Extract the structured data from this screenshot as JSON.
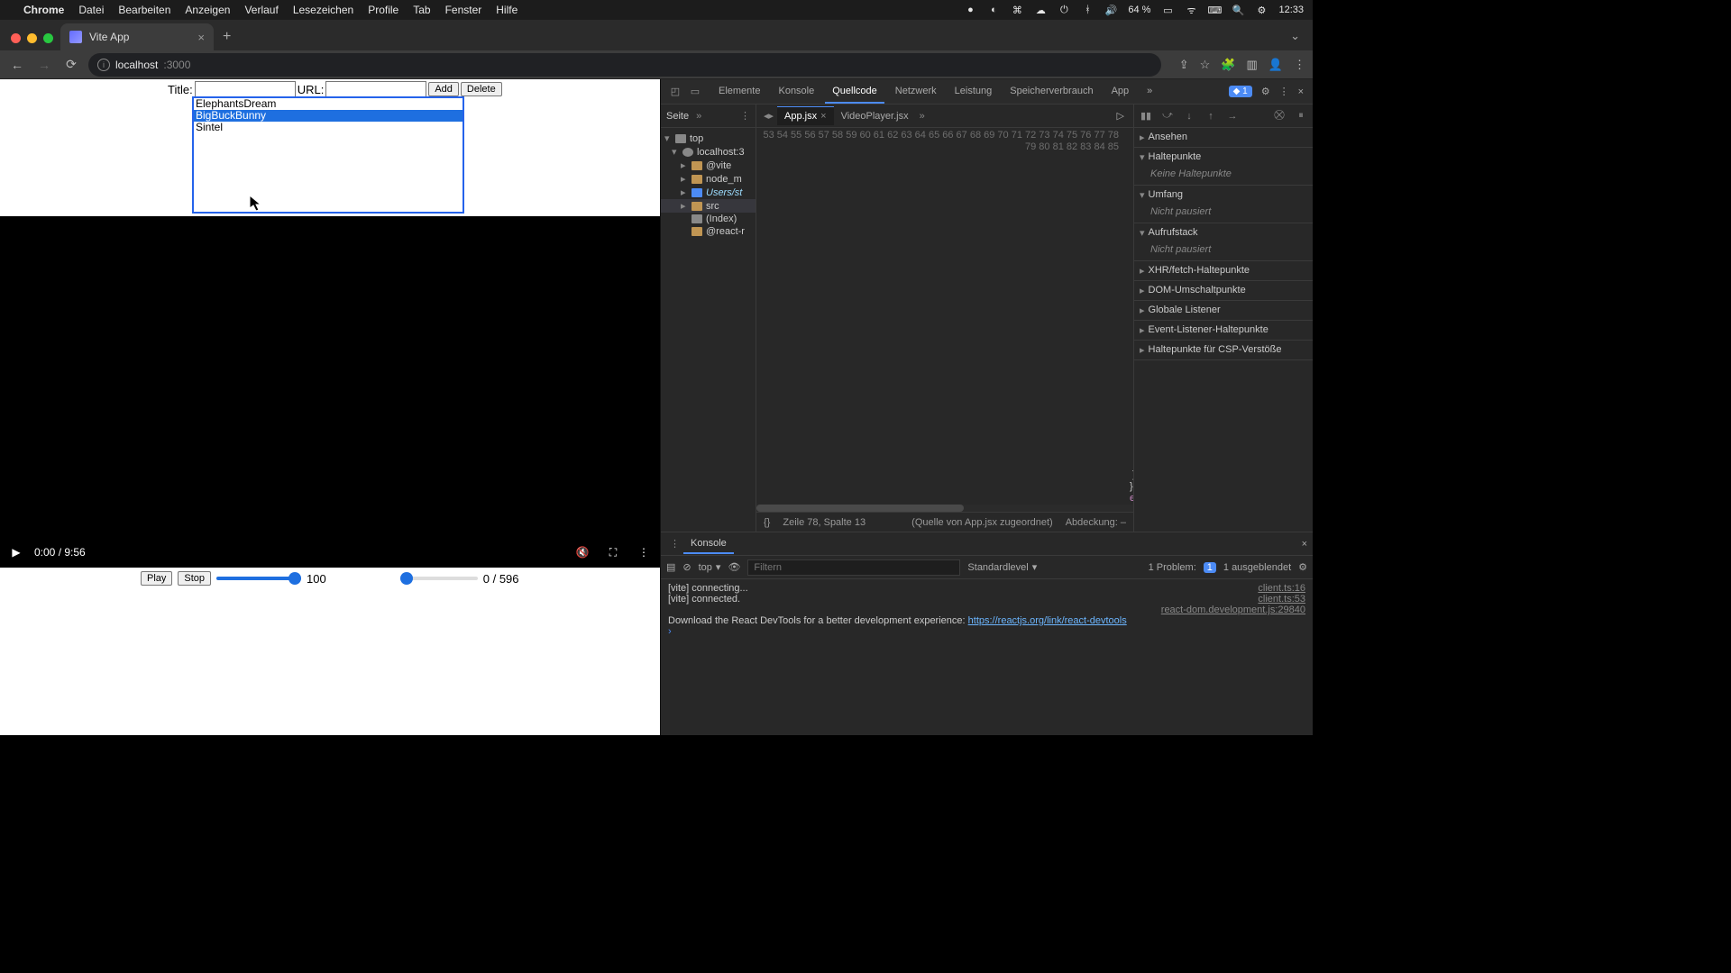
{
  "menubar": {
    "apple": "",
    "app": "Chrome",
    "items": [
      "Datei",
      "Bearbeiten",
      "Anzeigen",
      "Verlauf",
      "Lesezeichen",
      "Profile",
      "Tab",
      "Fenster",
      "Hilfe"
    ],
    "battery": "64 %",
    "time": "12:33"
  },
  "chrome": {
    "tab_title": "Vite App",
    "url_host": "localhost",
    "url_path": ":3000"
  },
  "page": {
    "title_label": "Title:",
    "url_label": "URL:",
    "add_btn": "Add",
    "delete_btn": "Delete",
    "options": [
      "ElephantsDream",
      "BigBuckBunny",
      "Sintel"
    ],
    "selected_index": 1,
    "video_time": "0:00 / 9:56",
    "play_btn": "Play",
    "stop_btn": "Stop",
    "vol_value": "100",
    "seek_value": "0 / 596"
  },
  "devtools": {
    "tabs": [
      "Elemente",
      "Konsole",
      "Quellcode",
      "Netzwerk",
      "Leistung",
      "Speicherverbrauch",
      "App"
    ],
    "active_tab": "Quellcode",
    "issues_badge": "1",
    "sources_subtab": "Seite",
    "tree": {
      "top": "top",
      "host": "localhost:3",
      "vite": "@vite",
      "node_m": "node_m",
      "users": "Users/st",
      "src": "src",
      "index": "(Index)",
      "react_r": "@react-r"
    },
    "file_tabs": [
      "App.jsx",
      "VideoPlayer.jsx"
    ],
    "active_file": "App.jsx",
    "gutter": [
      "53",
      "54",
      "55",
      "56",
      "57",
      "58",
      "59",
      "60",
      "61",
      "62",
      "63",
      "64",
      "65",
      "66",
      "67",
      "68",
      "69",
      "70",
      "71",
      "72",
      "73",
      "74",
      "75",
      "76",
      "77",
      "78",
      "79",
      "80",
      "81",
      "82",
      "83",
      "84",
      "85"
    ],
    "status_line": "Zeile 78, Spalte 13",
    "status_src": "(Quelle von App.jsx zugeordnet)",
    "status_cov": "Abdeckung: –",
    "dbg": {
      "ansehen": "Ansehen",
      "haltepunkte": "Haltepunkte",
      "haltepunkte_body": "Keine Haltepunkte",
      "umfang": "Umfang",
      "umfang_body": "Nicht pausiert",
      "aufrufstack": "Aufrufstack",
      "aufrufstack_body": "Nicht pausiert",
      "xhr": "XHR/fetch-Haltepunkte",
      "dom": "DOM-Umschaltpunkte",
      "global": "Globale Listener",
      "evt": "Event-Listener-Haltepunkte",
      "csp": "Haltepunkte für CSP-Verstöße"
    },
    "console": {
      "tab": "Konsole",
      "ctx": "top",
      "filter_placeholder": "Filtern",
      "level": "Standardlevel",
      "problems_label": "1 Problem:",
      "problems_count": "1",
      "hidden": "1 ausgeblendet",
      "lines": [
        {
          "text": "[vite] connecting...",
          "src": "client.ts:16"
        },
        {
          "text": "[vite] connected.",
          "src": "client.ts:53"
        },
        {
          "text": "",
          "src": "react-dom.development.js:29840"
        }
      ],
      "devtools_msg": "Download the React DevTools for a better development experience: ",
      "devtools_link": "https://reactjs.org/link/react-devtools"
    }
  }
}
